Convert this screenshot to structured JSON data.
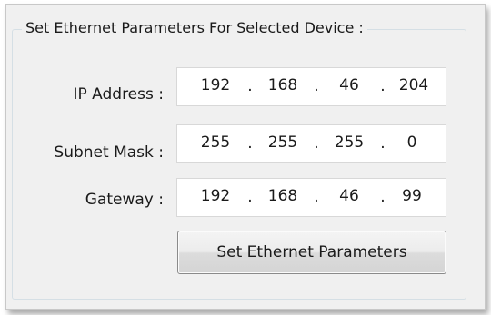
{
  "groupbox": {
    "title": "Set Ethernet Parameters For Selected Device :"
  },
  "fields": {
    "ip_address": {
      "label": "IP Address :",
      "octets": [
        "192",
        "168",
        "46",
        "204"
      ]
    },
    "subnet_mask": {
      "label": "Subnet Mask :",
      "octets": [
        "255",
        "255",
        "255",
        "0"
      ]
    },
    "gateway": {
      "label": "Gateway :",
      "octets": [
        "192",
        "168",
        "46",
        "99"
      ]
    }
  },
  "separator": ".",
  "buttons": {
    "set_label": "Set Ethernet Parameters"
  }
}
